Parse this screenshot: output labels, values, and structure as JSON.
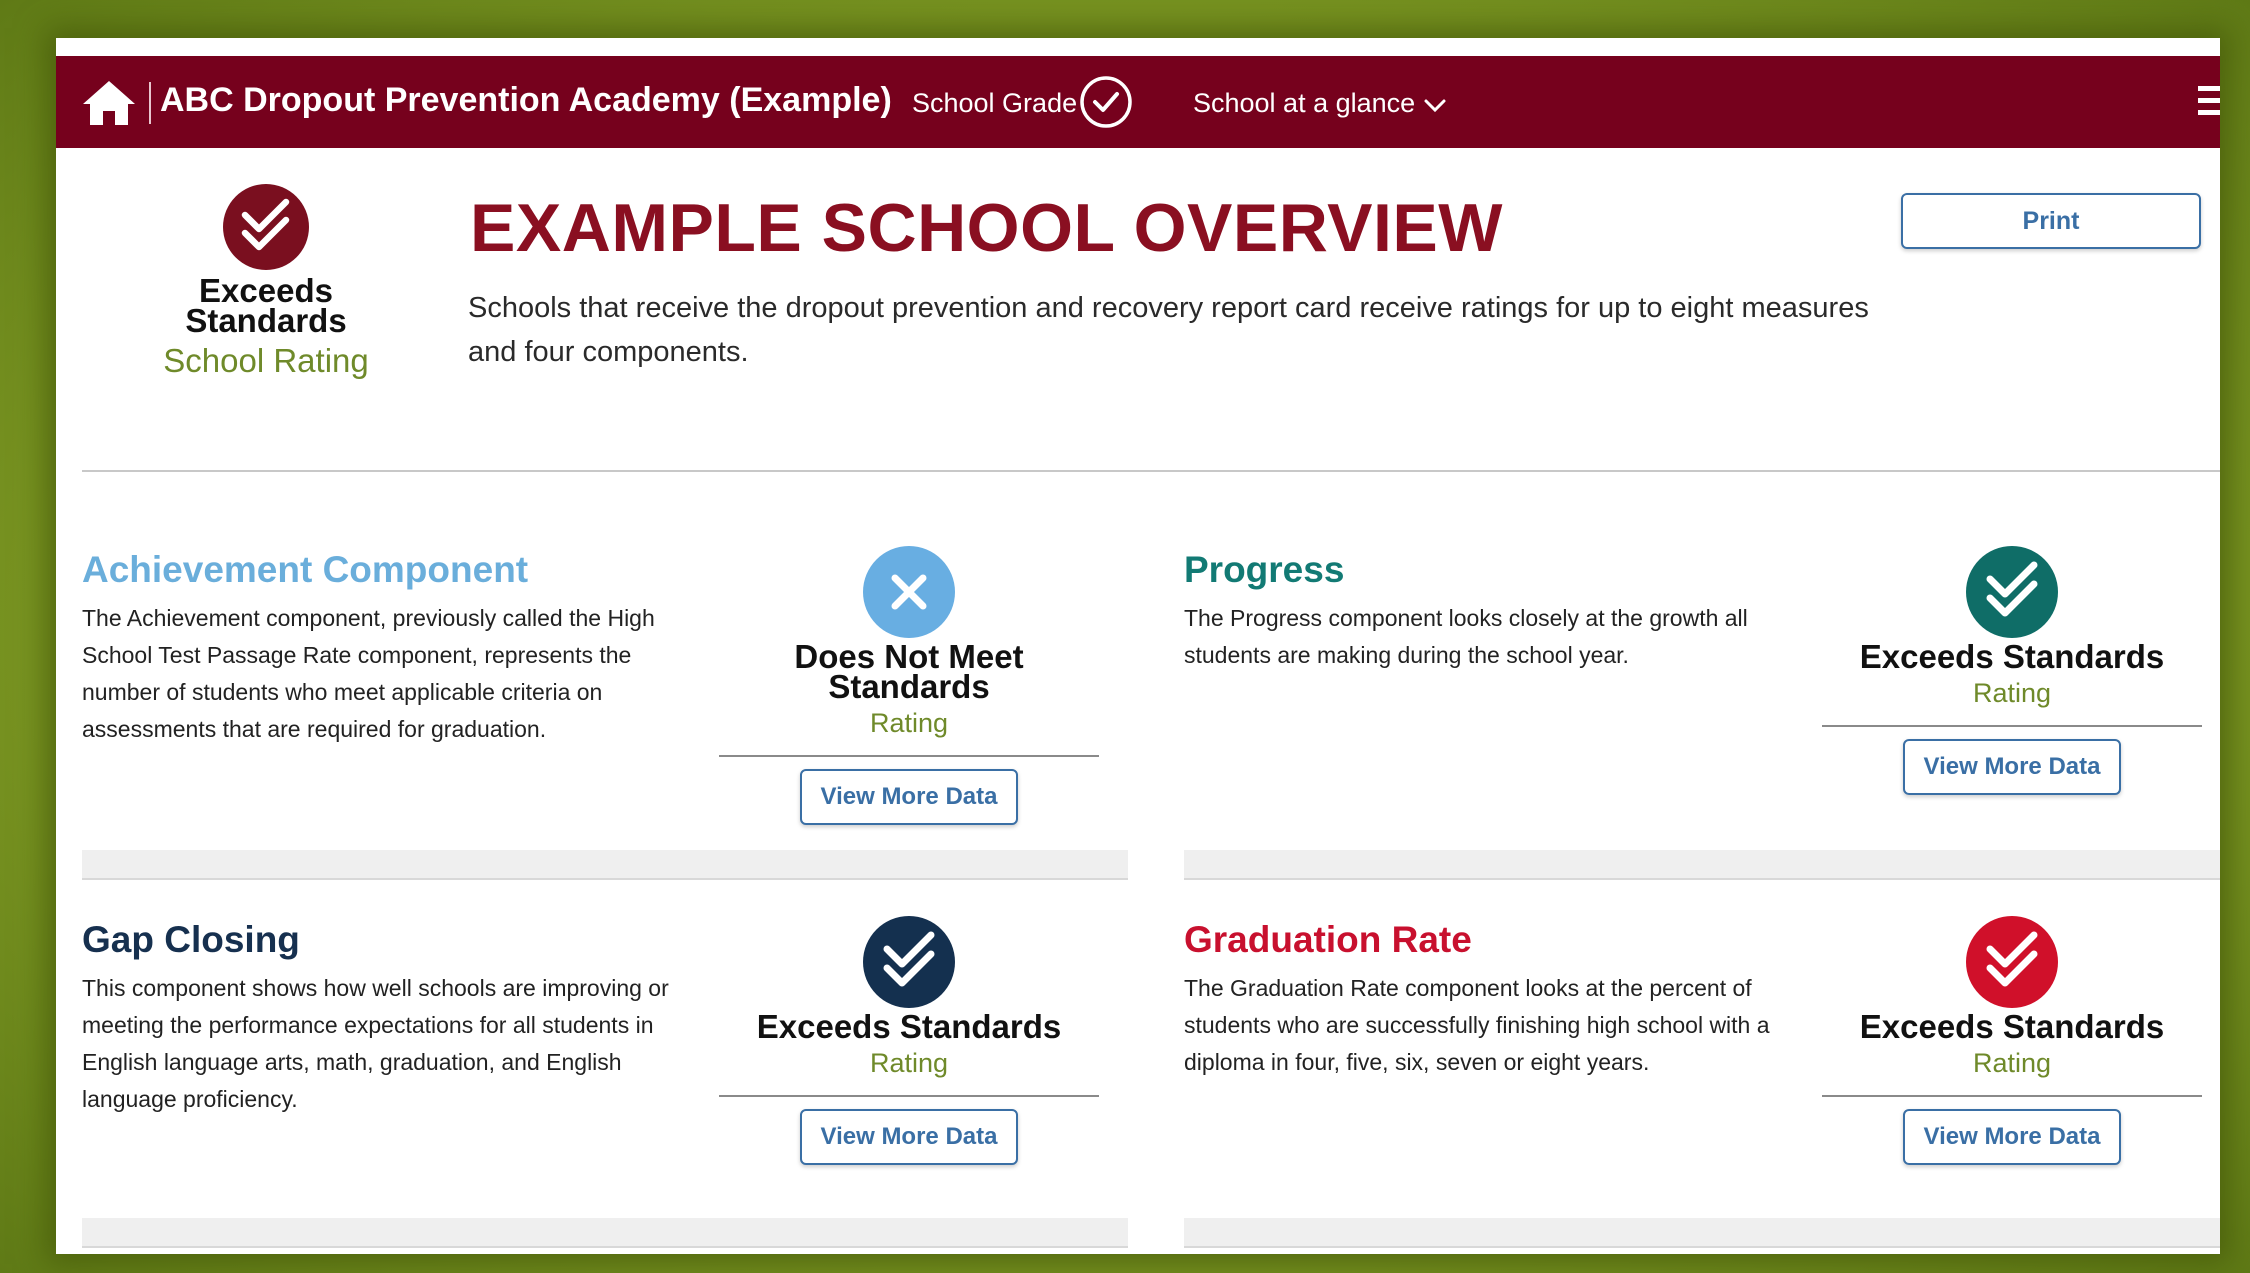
{
  "header": {
    "school_name": "ABC Dropout Prevention Academy (Example)",
    "grade_label": "School Grade",
    "glance_label": "School at a glance",
    "brand_color": "#76011d"
  },
  "school_rating": {
    "status": "Exceeds Standards",
    "label": "School Rating"
  },
  "overview": {
    "title": "EXAMPLE SCHOOL OVERVIEW",
    "description": "Schools that receive the dropout prevention and recovery report card receive ratings for up to eight measures and four components.",
    "print_label": "Print"
  },
  "components": [
    {
      "title": "Achievement Component",
      "title_color": "#6aaedb",
      "description": "The Achievement component, previously called the High School Test Passage Rate component, represents the number of students who meet applicable criteria on assessments that are required for graduation.",
      "rating": "Does Not Meet Standards",
      "rating_label": "Rating",
      "icon": "x-icon",
      "icon_color": "#68aee2",
      "button": "View More Data"
    },
    {
      "title": "Progress",
      "title_color": "#127a74",
      "description": "The Progress component looks closely at the growth all students are making during the school year.",
      "rating": "Exceeds Standards",
      "rating_label": "Rating",
      "icon": "check-icon",
      "icon_color": "#0f6d67",
      "button": "View More Data"
    },
    {
      "title": "Gap Closing",
      "title_color": "#16304f",
      "description": "This component shows how well schools are improving or meeting the performance expectations for all students in English language arts, math, graduation, and English language proficiency.",
      "rating": "Exceeds Standards",
      "rating_label": "Rating",
      "icon": "check-icon",
      "icon_color": "#14304f",
      "button": "View More Data"
    },
    {
      "title": "Graduation Rate",
      "title_color": "#c8102e",
      "description": "The Graduation Rate component looks at the percent of students who are successfully finishing high school with a diploma in four, five, six, seven or eight years.",
      "rating": "Exceeds Standards",
      "rating_label": "Rating",
      "icon": "check-icon",
      "icon_color": "#d0102a",
      "button": "View More Data"
    }
  ]
}
